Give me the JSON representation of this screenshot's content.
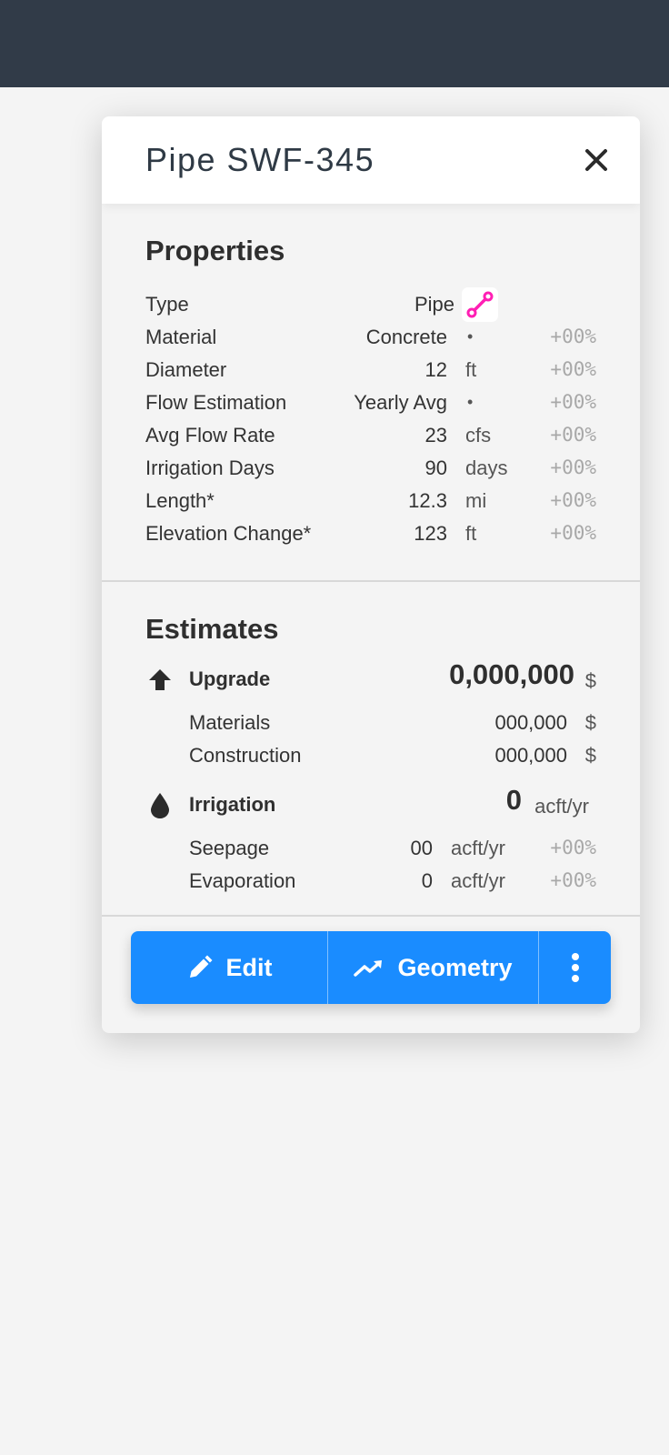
{
  "header": {
    "title": "Pipe SWF-345"
  },
  "properties": {
    "title": "Properties",
    "rows": [
      {
        "label": "Type",
        "value": "Pipe",
        "unit": "",
        "pct": ""
      },
      {
        "label": "Material",
        "value": "Concrete",
        "unit": "•",
        "pct": "+00%"
      },
      {
        "label": "Diameter",
        "value": "12",
        "unit": "ft",
        "pct": "+00%"
      },
      {
        "label": "Flow Estimation",
        "value": "Yearly Avg",
        "unit": "•",
        "pct": "+00%"
      },
      {
        "label": "Avg Flow Rate",
        "value": "23",
        "unit": "cfs",
        "pct": "+00%"
      },
      {
        "label": "Irrigation Days",
        "value": "90",
        "unit": "days",
        "pct": "+00%"
      },
      {
        "label": "Length*",
        "value": "12.3",
        "unit": "mi",
        "pct": "+00%"
      },
      {
        "label": "Elevation Change*",
        "value": "123",
        "unit": "ft",
        "pct": "+00%"
      }
    ]
  },
  "estimates": {
    "title": "Estimates",
    "upgrade": {
      "label": "Upgrade",
      "value": "0,000,000",
      "unit": "$",
      "items": [
        {
          "label": "Materials",
          "value": "000,000",
          "unit": "$"
        },
        {
          "label": "Construction",
          "value": "000,000",
          "unit": "$"
        }
      ]
    },
    "irrigation": {
      "label": "Irrigation",
      "value": "0",
      "unit": "acft/yr",
      "items": [
        {
          "label": "Seepage",
          "value": "00",
          "unit": "acft/yr",
          "pct": "+00%"
        },
        {
          "label": "Evaporation",
          "value": "0",
          "unit": "acft/yr",
          "pct": "+00%"
        }
      ]
    }
  },
  "actions": {
    "edit_label": "Edit",
    "geometry_label": "Geometry"
  },
  "colors": {
    "accent": "#1a8cff",
    "topbar": "#313b48",
    "type_icon": "#ff1fb4"
  },
  "icons": {
    "close": "close-icon",
    "type": "pipe-segment-icon",
    "upgrade": "arrow-up-icon",
    "irrigation": "water-drop-icon",
    "edit": "pencil-icon",
    "geometry": "trending-line-icon",
    "more": "more-vertical-icon"
  }
}
